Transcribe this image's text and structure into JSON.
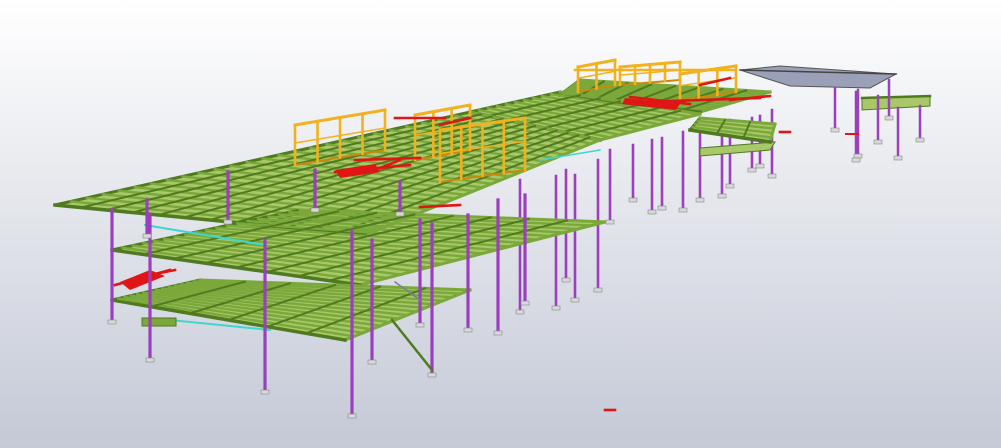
{
  "view": {
    "background_top": "#ffffff",
    "background_bottom": "#c4c9d6"
  },
  "colors": {
    "beam": "#7aa83a",
    "beam_dark": "#4f7a1f",
    "deck": "#a9c86a",
    "column": "#9b3fbf",
    "column_dark": "#6d2a8a",
    "railing": "#f2b21f",
    "railing_dark": "#c98a0a",
    "brace": "#e01515",
    "accent": "#3fd6d0",
    "roof_panel": "#9aa0b8"
  },
  "model": {
    "description_icon": "steel-frame-3d-model-icon"
  }
}
